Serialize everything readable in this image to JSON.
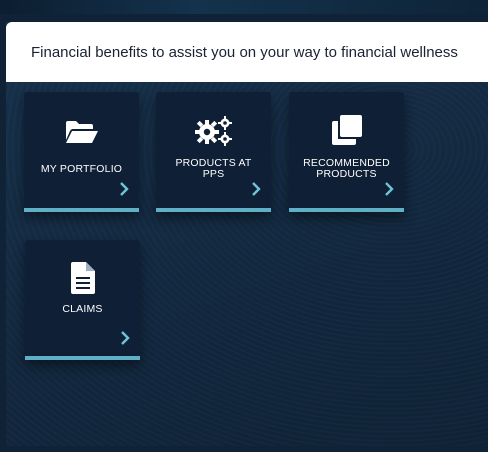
{
  "header": {
    "text": "Financial benefits to assist you on your way to financial wellness"
  },
  "tiles": [
    {
      "label": "MY PORTFOLIO",
      "icon": "folder-open-icon"
    },
    {
      "label": "PRODUCTS AT PPS",
      "icon": "gears-icon"
    },
    {
      "label": "RECOMMENDED PRODUCTS",
      "icon": "clone-icon"
    },
    {
      "label": "CLAIMS",
      "icon": "document-icon"
    }
  ],
  "colors": {
    "accent_bar": "#5fb0c6",
    "tile_bg": "#0f1f35",
    "chevron": "#6fc3d6"
  }
}
